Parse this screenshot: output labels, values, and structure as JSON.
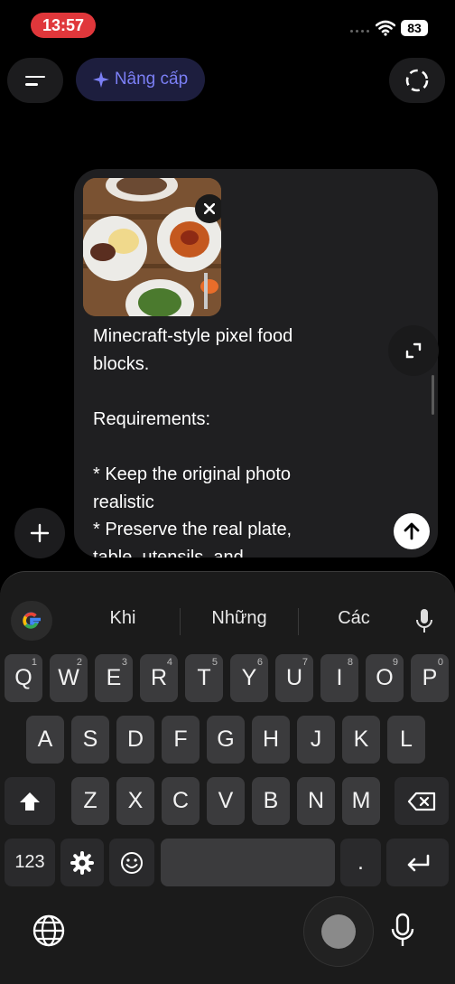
{
  "status": {
    "time": "13:57",
    "battery": "83"
  },
  "topbar": {
    "upgrade_label": "Nâng cấp",
    "upgrade_icon": "sparkle-icon",
    "menu_icon": "menu-icon",
    "right_icon": "dashed-circle-icon"
  },
  "composer": {
    "prompt": "Minecraft-style pixel food\nblocks.\n\nRequirements:\n\n* Keep the original photo\nrealistic\n* Preserve the real plate,\ntable, utensils, and",
    "attachment_icon": "image-thumbnail"
  },
  "keyboard": {
    "suggestions": [
      "Khi",
      "Những",
      "Các"
    ],
    "row1": [
      {
        "l": "Q",
        "h": "1"
      },
      {
        "l": "W",
        "h": "2"
      },
      {
        "l": "E",
        "h": "3"
      },
      {
        "l": "R",
        "h": "4"
      },
      {
        "l": "T",
        "h": "5"
      },
      {
        "l": "Y",
        "h": "6"
      },
      {
        "l": "U",
        "h": "7"
      },
      {
        "l": "I",
        "h": "8"
      },
      {
        "l": "O",
        "h": "9"
      },
      {
        "l": "P",
        "h": "0"
      }
    ],
    "row2": [
      "A",
      "S",
      "D",
      "F",
      "G",
      "H",
      "J",
      "K",
      "L"
    ],
    "row3": [
      "Z",
      "X",
      "C",
      "V",
      "B",
      "N",
      "M"
    ],
    "numbers_label": "123",
    "period_label": "."
  }
}
